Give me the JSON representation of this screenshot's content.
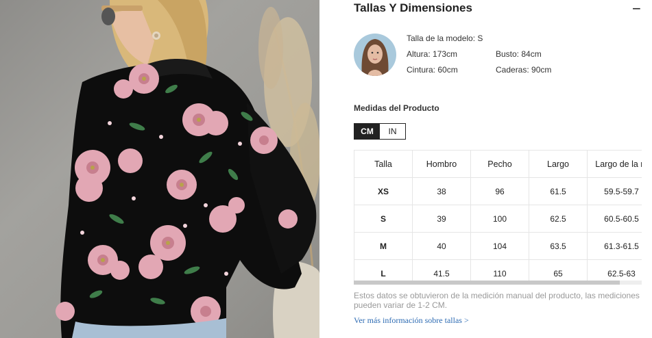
{
  "section": {
    "title": "Tallas Y Dimensiones",
    "collapse_symbol": "−"
  },
  "model": {
    "size": "Talla de la modelo: S",
    "height": "Altura: 173cm",
    "bust": "Busto: 84cm",
    "waist": "Cintura: 60cm",
    "hips": "Caderas: 90cm"
  },
  "product_measures": {
    "title": "Medidas del Producto",
    "units": [
      "CM",
      "IN"
    ],
    "active_unit": "CM"
  },
  "size_table": {
    "headers": [
      "Talla",
      "Hombro",
      "Pecho",
      "Largo",
      "Largo de la m"
    ],
    "rows": [
      [
        "XS",
        "38",
        "96",
        "61.5",
        "59.5-59.7"
      ],
      [
        "S",
        "39",
        "100",
        "62.5",
        "60.5-60.5"
      ],
      [
        "M",
        "40",
        "104",
        "63.5",
        "61.3-61.5"
      ],
      [
        "L",
        "41.5",
        "110",
        "65",
        "62.5-63"
      ]
    ]
  },
  "disclaimer": "Estos datos se obtuvieron de la medición manual del producto, las mediciones pueden variar de 1-2 CM.",
  "more_link": "Ver más información sobre tallas >",
  "colors": {
    "text": "#222222",
    "link": "#2d6bb3",
    "muted": "#999999",
    "border": "#e5e5e5"
  }
}
